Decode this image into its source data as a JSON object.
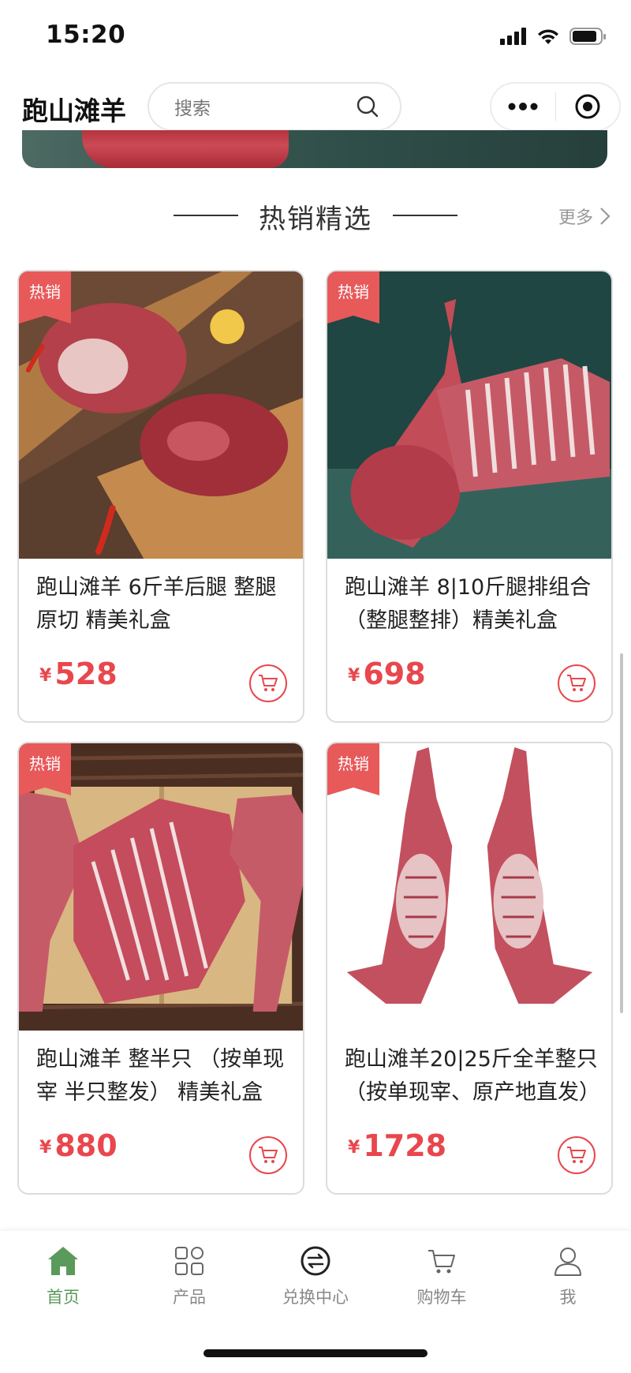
{
  "status_bar": {
    "time": "15:20"
  },
  "header": {
    "title": "跑山滩羊",
    "search_placeholder": "搜索"
  },
  "section": {
    "title": "热销精选",
    "more_label": "更多"
  },
  "products": [
    {
      "badge": "热销",
      "name": "跑山滩羊 6斤羊后腿 整腿原切 精美礼盒",
      "currency": "¥",
      "price": "528"
    },
    {
      "badge": "热销",
      "name": "跑山滩羊 8|10斤腿排组合 （整腿整排）精美礼盒",
      "currency": "¥",
      "price": "698"
    },
    {
      "badge": "热销",
      "name": "跑山滩羊 整半只 （按单现宰 半只整发） 精美礼盒",
      "currency": "¥",
      "price": "880"
    },
    {
      "badge": "热销",
      "name": "跑山滩羊20|25斤全羊整只（按单现宰、原产地直发）",
      "currency": "¥",
      "price": "1728"
    }
  ],
  "tabbar": {
    "items": [
      {
        "label": "首页",
        "icon": "home-icon",
        "active": true
      },
      {
        "label": "产品",
        "icon": "grid-icon",
        "active": false
      },
      {
        "label": "兑换中心",
        "icon": "exchange-icon",
        "active": false
      },
      {
        "label": "购物车",
        "icon": "cart-icon",
        "active": false
      },
      {
        "label": "我",
        "icon": "user-icon",
        "active": false
      }
    ],
    "active_color": "#5a9a5a",
    "inactive_color": "#888888"
  },
  "colors": {
    "accent_red": "#e8474d",
    "badge_red": "#e8595a"
  }
}
